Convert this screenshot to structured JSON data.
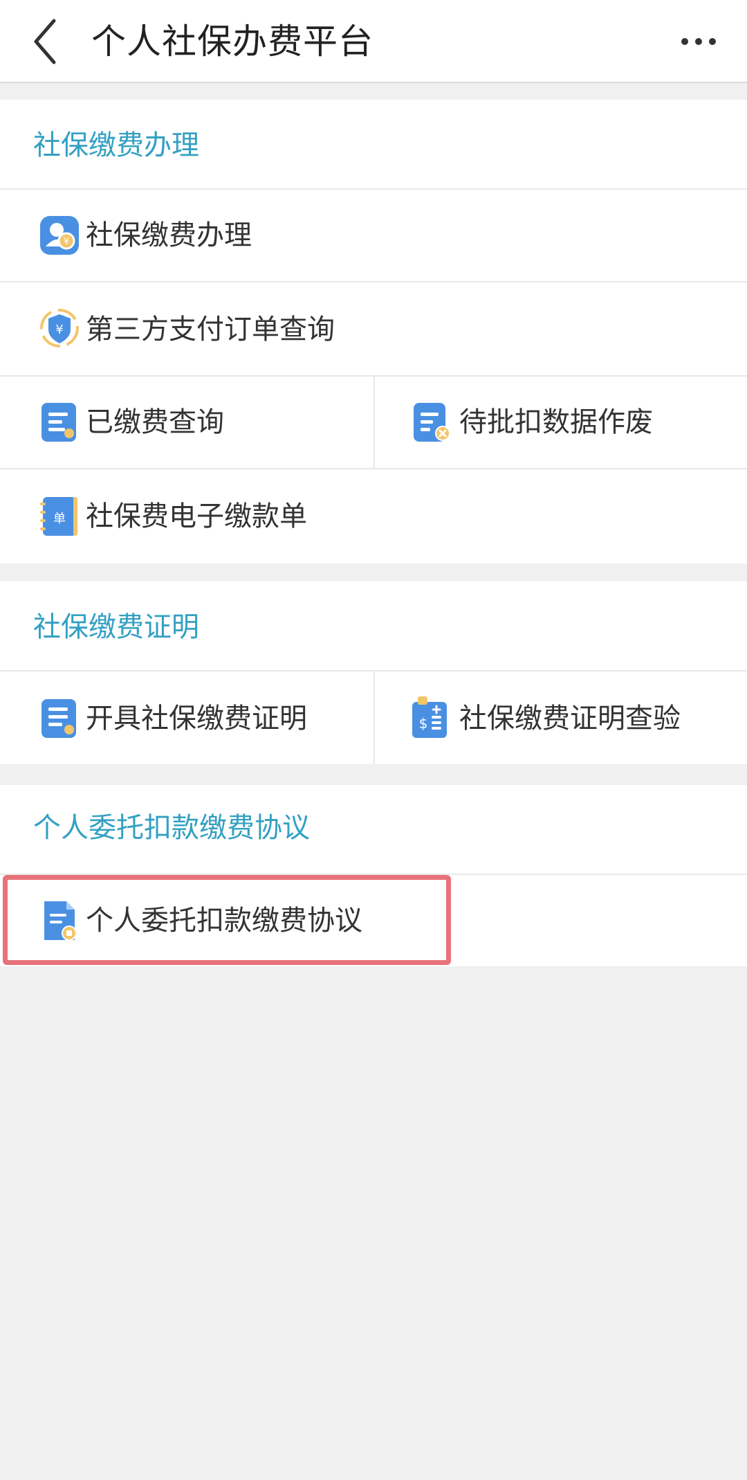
{
  "header": {
    "title": "个人社保办费平台"
  },
  "sections": [
    {
      "title": "社保缴费办理",
      "items": [
        {
          "label": "社保缴费办理",
          "icon": "person-coin-icon"
        },
        {
          "label": "第三方支付订单查询",
          "icon": "yuan-shield-icon"
        },
        {
          "label": "已缴费查询",
          "icon": "document-list-icon"
        },
        {
          "label": "待批扣数据作废",
          "icon": "document-cancel-icon"
        },
        {
          "label": "社保费电子缴款单",
          "icon": "receipt-book-icon",
          "badge": "单"
        }
      ]
    },
    {
      "title": "社保缴费证明",
      "items": [
        {
          "label": "开具社保缴费证明",
          "icon": "document-list-icon"
        },
        {
          "label": "社保缴费证明查验",
          "icon": "dollar-calculator-icon",
          "badge": "$"
        }
      ]
    },
    {
      "title": "个人委托扣款缴费协议",
      "items": [
        {
          "label": "个人委托扣款缴费协议",
          "icon": "agreement-document-icon",
          "highlighted": true
        }
      ]
    }
  ],
  "colors": {
    "accent": "#33a0c2",
    "icon_blue": "#4a90e2",
    "highlight": "#e8727a",
    "background": "#f0f0f0"
  }
}
